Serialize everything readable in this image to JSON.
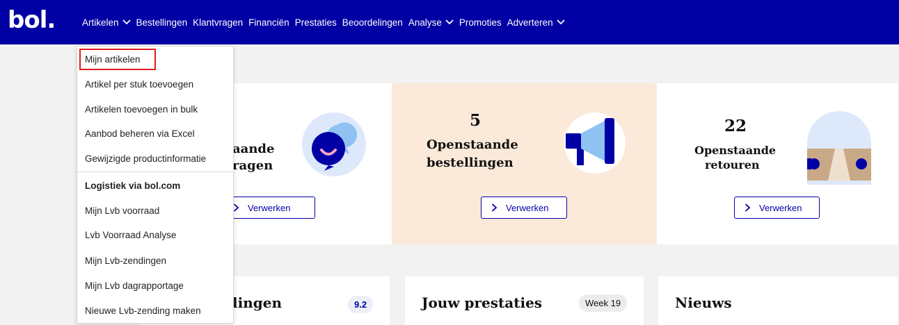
{
  "logo": "bol.",
  "nav": [
    "Artikelen",
    "Bestellingen",
    "Klantvragen",
    "Financiën",
    "Prestaties",
    "Beoordelingen",
    "Analyse",
    "Promoties",
    "Adverteren"
  ],
  "dropdown": {
    "items": [
      "Mijn artikelen",
      "Artikel per stuk toevoegen",
      "Artikelen toevoegen in bulk",
      "Aanbod beheren via Excel",
      "Gewijzigde productinformatie"
    ],
    "section": "Logistiek via bol.com",
    "lvb_items": [
      "Mijn Lvb voorraad",
      "Lvb Voorraad Analyse",
      "Mijn Lvb-zendingen",
      "Mijn Lvb dagrapportage",
      "Nieuwe Lvb-zending maken"
    ]
  },
  "cards": [
    {
      "count": "",
      "title1": "aande",
      "title2": "ragen",
      "button": "Verwerken"
    },
    {
      "count": "5",
      "title1": "Openstaande",
      "title2": "bestellingen",
      "button": "Verwerken"
    },
    {
      "count": "22",
      "title1": "Openstaande",
      "title2": "retouren",
      "button": "Verwerken"
    }
  ],
  "panels": {
    "p1_title": "lingen",
    "p1_score": "9.2",
    "p2_title": "Jouw prestaties",
    "p2_week": "Week 19",
    "p3_title": "Nieuws"
  },
  "colors": {
    "brand": "#0000a4",
    "highlight": "#e21b1b",
    "card_peach": "#fbe9d9"
  }
}
